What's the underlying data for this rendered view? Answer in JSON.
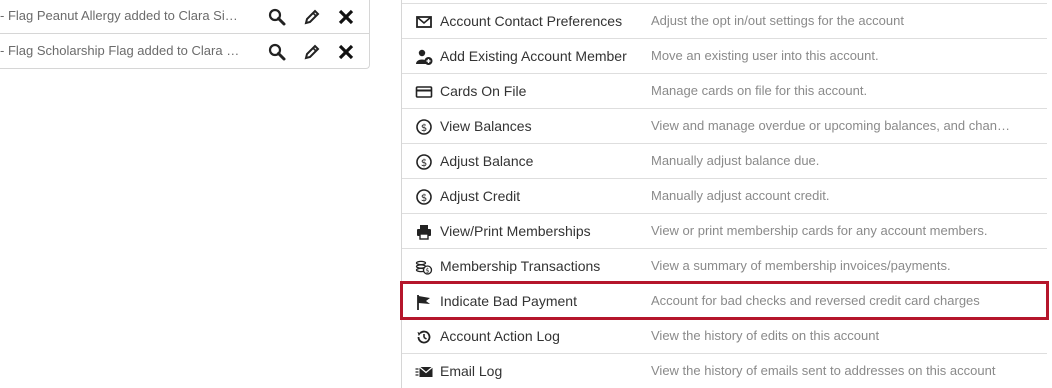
{
  "notes": [
    {
      "text": "- Flag Peanut Allergy added to Clara Sie..."
    },
    {
      "text": "- Flag Scholarship Flag added to Clara Si..."
    }
  ],
  "note_icons": {
    "view": "search-icon",
    "edit": "pencil-icon",
    "delete": "close-icon"
  },
  "actions": [
    {
      "icon": "envelope-icon",
      "label": "Account Contact Preferences",
      "desc": "Adjust the opt in/out settings for the account"
    },
    {
      "icon": "add-user-icon",
      "label": "Add Existing Account Member",
      "desc": "Move an existing user into this account."
    },
    {
      "icon": "credit-card-icon",
      "label": "Cards On File",
      "desc": "Manage cards on file for this account."
    },
    {
      "icon": "dollar-circle-icon",
      "label": "View Balances",
      "desc": "View and manage overdue or upcoming balances, and change t..."
    },
    {
      "icon": "dollar-circle-icon",
      "label": "Adjust Balance",
      "desc": "Manually adjust balance due."
    },
    {
      "icon": "dollar-circle-icon",
      "label": "Adjust Credit",
      "desc": "Manually adjust account credit."
    },
    {
      "icon": "printer-icon",
      "label": "View/Print Memberships",
      "desc": "View or print membership cards for any account members."
    },
    {
      "icon": "coins-icon",
      "label": "Membership Transactions",
      "desc": "View a summary of membership invoices/payments."
    },
    {
      "icon": "flag-icon",
      "label": "Indicate Bad Payment",
      "desc": "Account for bad checks and reversed credit card charges"
    },
    {
      "icon": "history-icon",
      "label": "Account Action Log",
      "desc": "View the history of edits on this account"
    },
    {
      "icon": "email-send-icon",
      "label": "Email Log",
      "desc": "View the history of emails sent to addresses on this account"
    }
  ],
  "highlighted_action": "Indicate Bad Payment",
  "colors": {
    "highlight": "#b5162b",
    "text": "#333333",
    "muted": "#8a8a8a"
  }
}
